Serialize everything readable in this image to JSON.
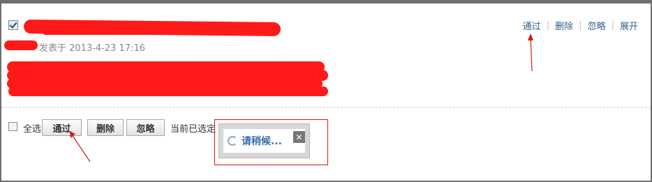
{
  "post": {
    "meta_text": "发表于 2013-4-23 17:16"
  },
  "actions_top": {
    "pass": "通过",
    "delete": "删除",
    "ignore": "忽略",
    "expand": "展开"
  },
  "bulk": {
    "select_all": "全选",
    "pass": "通过",
    "delete": "删除",
    "ignore": "忽略",
    "selected_info": "当前已选定 1 个"
  },
  "loading": {
    "text": "请稍候...",
    "close_icon": "close-icon"
  },
  "colors": {
    "link": "#2f5f93",
    "annotation": "#d21a1a",
    "redaction": "#ff1a1a"
  }
}
